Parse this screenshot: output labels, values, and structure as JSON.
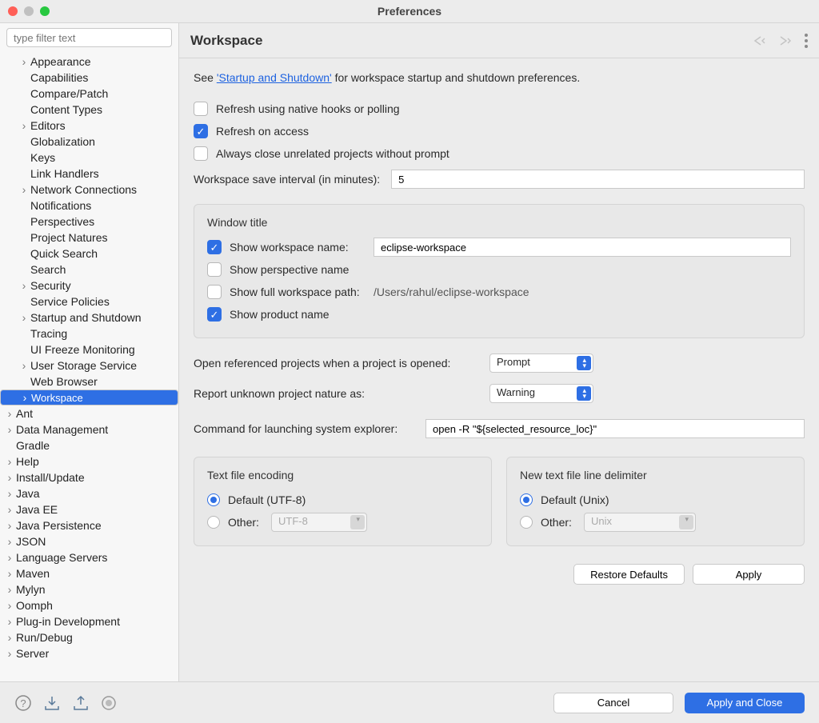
{
  "window": {
    "title": "Preferences"
  },
  "filter": {
    "placeholder": "type filter text"
  },
  "tree": [
    {
      "label": "Appearance",
      "depth": 1,
      "expandable": true
    },
    {
      "label": "Capabilities",
      "depth": 1,
      "expandable": false
    },
    {
      "label": "Compare/Patch",
      "depth": 1,
      "expandable": false
    },
    {
      "label": "Content Types",
      "depth": 1,
      "expandable": false
    },
    {
      "label": "Editors",
      "depth": 1,
      "expandable": true
    },
    {
      "label": "Globalization",
      "depth": 1,
      "expandable": false
    },
    {
      "label": "Keys",
      "depth": 1,
      "expandable": false
    },
    {
      "label": "Link Handlers",
      "depth": 1,
      "expandable": false
    },
    {
      "label": "Network Connections",
      "depth": 1,
      "expandable": true
    },
    {
      "label": "Notifications",
      "depth": 1,
      "expandable": false
    },
    {
      "label": "Perspectives",
      "depth": 1,
      "expandable": false
    },
    {
      "label": "Project Natures",
      "depth": 1,
      "expandable": false
    },
    {
      "label": "Quick Search",
      "depth": 1,
      "expandable": false
    },
    {
      "label": "Search",
      "depth": 1,
      "expandable": false
    },
    {
      "label": "Security",
      "depth": 1,
      "expandable": true
    },
    {
      "label": "Service Policies",
      "depth": 1,
      "expandable": false
    },
    {
      "label": "Startup and Shutdown",
      "depth": 1,
      "expandable": true
    },
    {
      "label": "Tracing",
      "depth": 1,
      "expandable": false
    },
    {
      "label": "UI Freeze Monitoring",
      "depth": 1,
      "expandable": false
    },
    {
      "label": "User Storage Service",
      "depth": 1,
      "expandable": true
    },
    {
      "label": "Web Browser",
      "depth": 1,
      "expandable": false
    },
    {
      "label": "Workspace",
      "depth": 1,
      "expandable": true,
      "selected": true
    },
    {
      "label": "Ant",
      "depth": 0,
      "expandable": true
    },
    {
      "label": "Data Management",
      "depth": 0,
      "expandable": true
    },
    {
      "label": "Gradle",
      "depth": 0,
      "expandable": false
    },
    {
      "label": "Help",
      "depth": 0,
      "expandable": true
    },
    {
      "label": "Install/Update",
      "depth": 0,
      "expandable": true
    },
    {
      "label": "Java",
      "depth": 0,
      "expandable": true
    },
    {
      "label": "Java EE",
      "depth": 0,
      "expandable": true
    },
    {
      "label": "Java Persistence",
      "depth": 0,
      "expandable": true
    },
    {
      "label": "JSON",
      "depth": 0,
      "expandable": true
    },
    {
      "label": "Language Servers",
      "depth": 0,
      "expandable": true
    },
    {
      "label": "Maven",
      "depth": 0,
      "expandable": true
    },
    {
      "label": "Mylyn",
      "depth": 0,
      "expandable": true
    },
    {
      "label": "Oomph",
      "depth": 0,
      "expandable": true
    },
    {
      "label": "Plug-in Development",
      "depth": 0,
      "expandable": true
    },
    {
      "label": "Run/Debug",
      "depth": 0,
      "expandable": true
    },
    {
      "label": "Server",
      "depth": 0,
      "expandable": true
    }
  ],
  "page": {
    "heading": "Workspace",
    "intro_prefix": "See ",
    "intro_link": "'Startup and Shutdown'",
    "intro_suffix": " for workspace startup and shutdown preferences.",
    "refresh_native": {
      "label": "Refresh using native hooks or polling",
      "checked": false
    },
    "refresh_access": {
      "label": "Refresh on access",
      "checked": true
    },
    "close_unrelated": {
      "label": "Always close unrelated projects without prompt",
      "checked": false
    },
    "save_interval_label": "Workspace save interval (in minutes):",
    "save_interval_value": "5",
    "window_title": {
      "title": "Window title",
      "show_ws_name": {
        "label": "Show workspace name:",
        "checked": true,
        "value": "eclipse-workspace"
      },
      "show_persp": {
        "label": "Show perspective name",
        "checked": false
      },
      "show_full_path": {
        "label": "Show full workspace path:",
        "checked": false,
        "value": "/Users/rahul/eclipse-workspace"
      },
      "show_product": {
        "label": "Show product name",
        "checked": true
      }
    },
    "open_referenced_label": "Open referenced projects when a project is opened:",
    "open_referenced_value": "Prompt",
    "unknown_nature_label": "Report unknown project nature as:",
    "unknown_nature_value": "Warning",
    "explorer_cmd_label": "Command for launching system explorer:",
    "explorer_cmd_value": "open -R \"${selected_resource_loc}\"",
    "encoding": {
      "title": "Text file encoding",
      "default_label": "Default (UTF-8)",
      "other_label": "Other:",
      "other_value": "UTF-8"
    },
    "delimiter": {
      "title": "New text file line delimiter",
      "default_label": "Default (Unix)",
      "other_label": "Other:",
      "other_value": "Unix"
    },
    "restore_defaults": "Restore Defaults",
    "apply": "Apply"
  },
  "footer": {
    "cancel": "Cancel",
    "apply_close": "Apply and Close"
  }
}
